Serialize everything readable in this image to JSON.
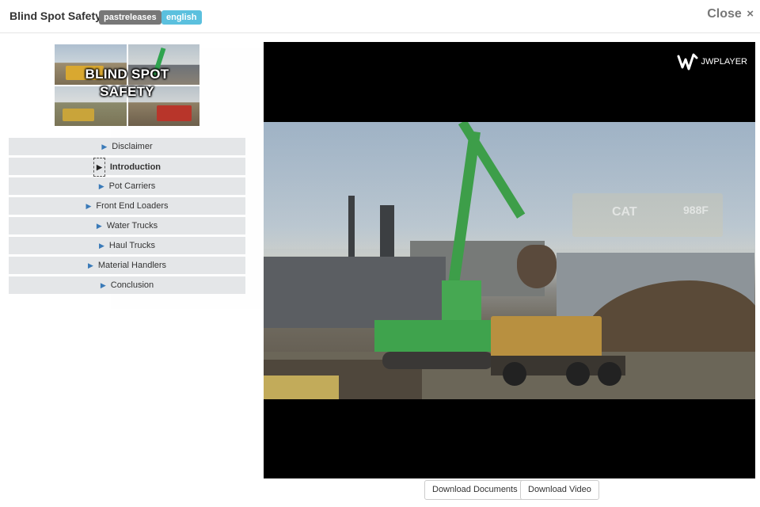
{
  "header": {
    "title": "Blind Spot Safety",
    "badges": [
      "pastreleases",
      "english"
    ],
    "close_label": "Close",
    "close_glyph": "×"
  },
  "thumbnail": {
    "line1": "BLIND SPOT",
    "line2": "SAFETY"
  },
  "menu": {
    "items": [
      {
        "label": "Disclaimer",
        "active": false
      },
      {
        "label": "Introduction",
        "active": true
      },
      {
        "label": "Pot Carriers",
        "active": false
      },
      {
        "label": "Front End Loaders",
        "active": false
      },
      {
        "label": "Water Trucks",
        "active": false
      },
      {
        "label": "Haul Trucks",
        "active": false
      },
      {
        "label": "Material Handlers",
        "active": false
      },
      {
        "label": "Conclusion",
        "active": false
      }
    ]
  },
  "player": {
    "brand": "JWPLAYER",
    "overlay_text_1": "CAT",
    "overlay_text_2": "988F"
  },
  "buttons": {
    "download_documents": "Download Documents",
    "download_video": "Download Video"
  },
  "colors": {
    "badge_gray": "#777777",
    "badge_blue": "#5bc0de",
    "menu_arrow": "#3a7ab8"
  }
}
